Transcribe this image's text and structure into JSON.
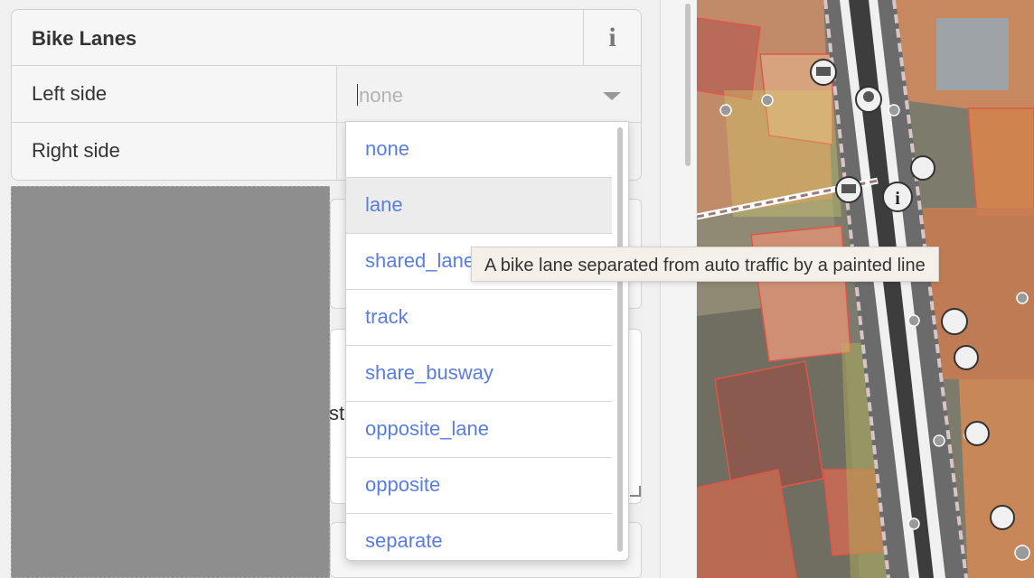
{
  "field": {
    "title": "Bike Lanes",
    "info_glyph": "i",
    "rows": [
      {
        "label": "Left side",
        "value": "",
        "placeholder": "none"
      },
      {
        "label": "Right side",
        "value": ""
      }
    ]
  },
  "dropdown": {
    "options": [
      "none",
      "lane",
      "shared_lane",
      "track",
      "share_busway",
      "opposite_lane",
      "opposite",
      "separate"
    ],
    "hovered": "lane"
  },
  "tooltip": {
    "text": "A bike lane separated from auto traffic by a painted line"
  },
  "background_fragments": {
    "partial_text": "st"
  },
  "colors": {
    "option_text": "#5a7de0",
    "tooltip_bg": "#f4efe8",
    "map_roof": "#c7735d",
    "map_outline": "#e0554a"
  }
}
